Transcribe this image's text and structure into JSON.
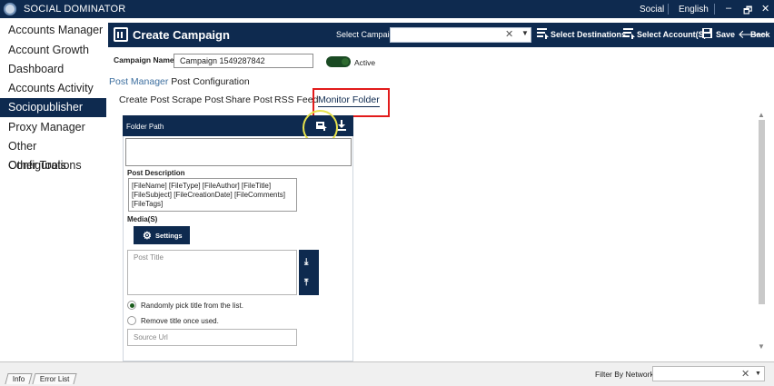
{
  "titlebar": {
    "app_title": "SOCIAL DOMINATOR",
    "social": "Social",
    "language": "English",
    "minimize": "–",
    "restore": "🗗",
    "close": "✕"
  },
  "sidebar": {
    "items": [
      {
        "label": "Accounts Manager"
      },
      {
        "label": "Account Growth"
      },
      {
        "label": "Dashboard"
      },
      {
        "label": "Accounts Activity"
      },
      {
        "label": "Sociopublisher",
        "active": true
      },
      {
        "label": "Proxy Manager"
      },
      {
        "label": "Other Configurations"
      },
      {
        "label": "Other Tools"
      }
    ]
  },
  "header": {
    "title": "Create Campaign",
    "select_campaign_label": "Select Campaign",
    "select_campaign_value": "",
    "clear": "✕",
    "dropdown": "▼",
    "select_destinations": "Select Destinations",
    "select_accounts": "Select Account(S)",
    "save": "Save",
    "back": "Back"
  },
  "campaign": {
    "name_label": "Campaign Name",
    "name_value": "Campaign 1549287842",
    "status": "Active"
  },
  "breadcrumb": {
    "parent": "Post Manager",
    "current": "Post Configuration"
  },
  "tabs": [
    {
      "label": "Create Post"
    },
    {
      "label": "Scrape Post"
    },
    {
      "label": "Share Post"
    },
    {
      "label": "RSS Feed"
    },
    {
      "label": "Monitor Folder",
      "selected": true
    }
  ],
  "panel": {
    "folder_path_label": "Folder Path",
    "folder_path_value": "",
    "post_description_label": "Post Description",
    "post_description_value": "[FileName] [FileType] [FileAuthor] [FileTitle] [FileSubject] [FileCreationDate] [FileComments] [FileTags]",
    "media_label": "Media(S)",
    "settings_button": "Settings",
    "post_title_placeholder": "Post Title",
    "random_pick_label": "Randomly pick title from the list.",
    "remove_title_label": "Remove title once used.",
    "source_url_placeholder": "Source Url"
  },
  "bottom": {
    "tab_info": "Info",
    "tab_error_list": "Error List",
    "filter_label": "Filter By Network",
    "filter_clear": "✕",
    "filter_dropdown": "▼"
  },
  "colors": {
    "navy": "#0e2a4f",
    "highlight_red": "#e21b1b",
    "cursor_ring_yellow": "#e8e34d",
    "toggle_green": "#1a4a23"
  }
}
